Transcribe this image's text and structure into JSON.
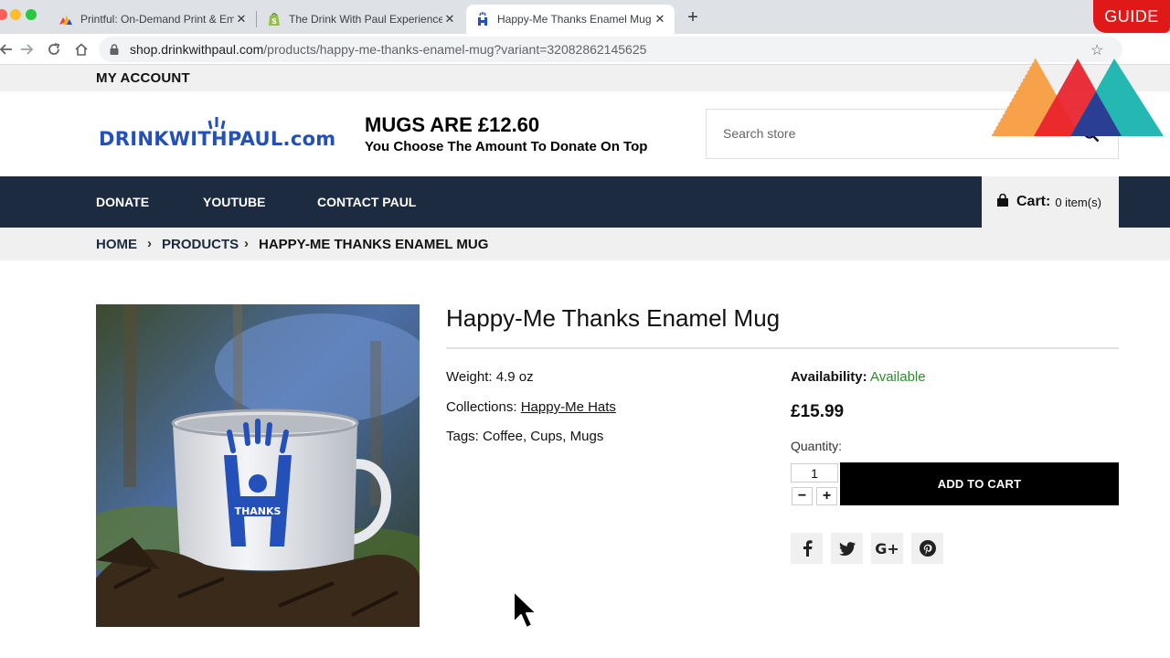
{
  "browser": {
    "tabs": [
      {
        "title": "Printful: On-Demand Print & Em",
        "close": "✕",
        "active": false
      },
      {
        "title": "The Drink With Paul Experience",
        "close": "✕",
        "active": false
      },
      {
        "title": "Happy-Me Thanks Enamel Mug",
        "close": "✕",
        "active": true
      }
    ],
    "new_tab": "+",
    "url_host": "shop.drinkwithpaul.com",
    "url_path": "/products/happy-me-thanks-enamel-mug?variant=32082862145625"
  },
  "overlay": {
    "badge": "GUIDE"
  },
  "site": {
    "account_link": "MY ACCOUNT",
    "logo_text": "DRINKWITHPAUL.com",
    "promo_title": "MUGS ARE £12.60",
    "promo_subtitle": "You Choose The Amount To Donate On Top",
    "search_placeholder": "Search store",
    "nav": [
      "DONATE",
      "YOUTUBE",
      "CONTACT PAUL"
    ],
    "cart_label": "Cart:",
    "cart_count": "0 item(s)",
    "breadcrumb": [
      "HOME",
      "PRODUCTS",
      "HAPPY-ME THANKS ENAMEL MUG"
    ],
    "breadcrumb_sep": "›"
  },
  "product": {
    "title": "Happy-Me Thanks Enamel Mug",
    "weight_label": "Weight:",
    "weight_value": "4.9 oz",
    "collections_label": "Collections:",
    "collections_value": "Happy-Me Hats",
    "tags_label": "Tags:",
    "tags_value": "Coffee, Cups, Mugs",
    "availability_label": "Availability:",
    "availability_value": "Available",
    "price": "£15.99",
    "quantity_label": "Quantity:",
    "quantity_value": "1",
    "minus": "−",
    "plus": "+",
    "add_to_cart": "ADD TO CART",
    "mug_print": "THANKS",
    "share_icons": [
      "facebook-icon",
      "twitter-icon",
      "google-plus-icon",
      "pinterest-icon"
    ],
    "google_plus_text": "G+"
  },
  "colors": {
    "nav_bg": "#1c2b3f",
    "logo_blue": "#2350b9",
    "available_green": "#2d8a2d",
    "guide_red": "#e01818"
  }
}
